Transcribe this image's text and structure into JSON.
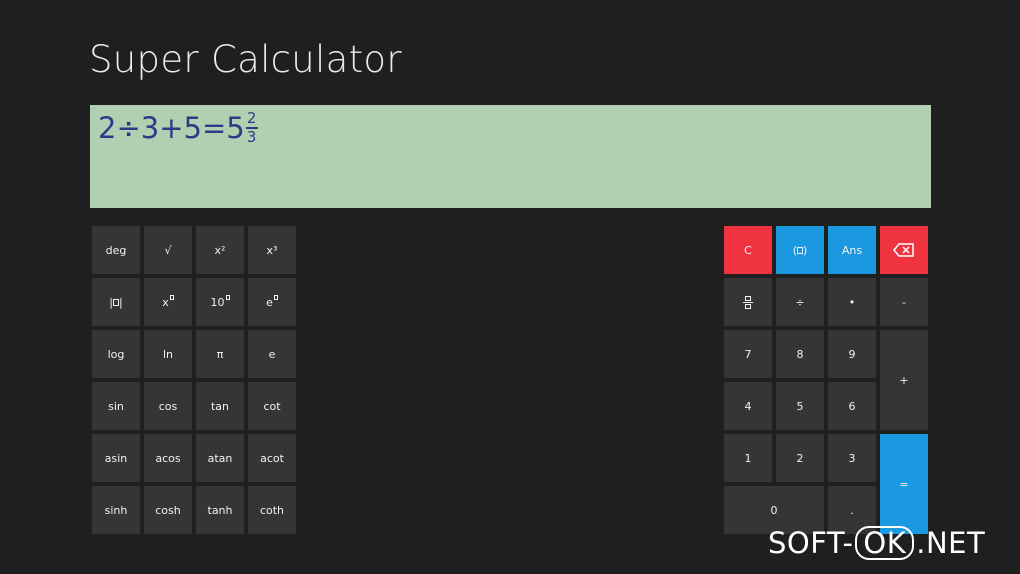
{
  "app": {
    "title": "Super Calculator"
  },
  "display": {
    "expression": "2÷3+5=5",
    "frac_num": "2",
    "frac_den": "3"
  },
  "sci_keys": [
    {
      "label": "deg",
      "name": "deg-key"
    },
    {
      "label": "√",
      "name": "sqrt-key"
    },
    {
      "label": "x²",
      "name": "square-key"
    },
    {
      "label": "x³",
      "name": "cube-key"
    },
    {
      "label": "",
      "name": "abs-key"
    },
    {
      "label": "x",
      "name": "power-key"
    },
    {
      "label": "10",
      "name": "pow10-key"
    },
    {
      "label": "e",
      "name": "exp-key"
    },
    {
      "label": "log",
      "name": "log-key"
    },
    {
      "label": "ln",
      "name": "ln-key"
    },
    {
      "label": "π",
      "name": "pi-key"
    },
    {
      "label": "e",
      "name": "e-constant-key"
    },
    {
      "label": "sin",
      "name": "sin-key"
    },
    {
      "label": "cos",
      "name": "cos-key"
    },
    {
      "label": "tan",
      "name": "tan-key"
    },
    {
      "label": "cot",
      "name": "cot-key"
    },
    {
      "label": "asin",
      "name": "asin-key"
    },
    {
      "label": "acos",
      "name": "acos-key"
    },
    {
      "label": "atan",
      "name": "atan-key"
    },
    {
      "label": "acot",
      "name": "acot-key"
    },
    {
      "label": "sinh",
      "name": "sinh-key"
    },
    {
      "label": "cosh",
      "name": "cosh-key"
    },
    {
      "label": "tanh",
      "name": "tanh-key"
    },
    {
      "label": "coth",
      "name": "coth-key"
    }
  ],
  "num_keys": {
    "clear": "C",
    "paren": "(",
    "paren_close": ")",
    "ans": "Ans",
    "backspace_icon": "backspace-icon",
    "fraction_icon": "fraction-icon",
    "divide": "÷",
    "multiply": "•",
    "minus": "-",
    "seven": "7",
    "eight": "8",
    "nine": "9",
    "plus": "+",
    "four": "4",
    "five": "5",
    "six": "6",
    "one": "1",
    "two": "2",
    "three": "3",
    "equals": "=",
    "zero": "0",
    "dot": "."
  },
  "colors": {
    "background": "#1f1f1f",
    "key": "#343536",
    "display": "#b3cfb2",
    "display_text": "#2e3a86",
    "red_accent": "#ef3440",
    "blue_accent": "#1a98e0"
  },
  "watermark": {
    "left": "SOFT-",
    "mid": "OK",
    "right": ".NET"
  }
}
